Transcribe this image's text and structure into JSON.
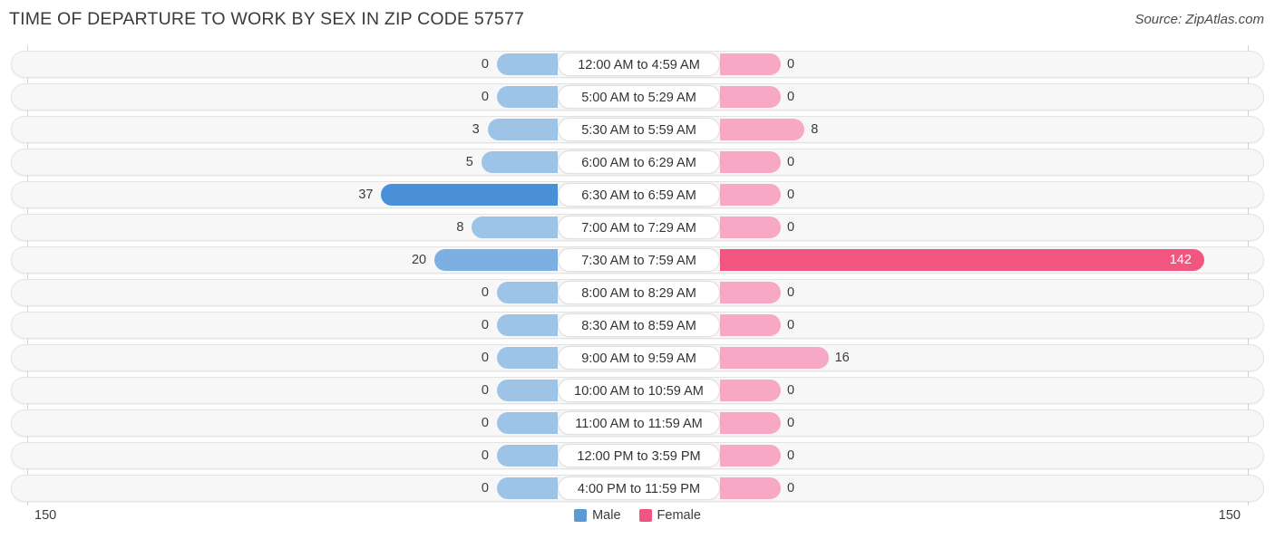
{
  "header": {
    "title": "TIME OF DEPARTURE TO WORK BY SEX IN ZIP CODE 57577",
    "source": "Source: ZipAtlas.com"
  },
  "legend": {
    "male_label": "Male",
    "female_label": "Female",
    "male_color": "#5b9bd5",
    "female_color": "#f2557f"
  },
  "axis": {
    "left_max": "150",
    "right_max": "150"
  },
  "chart_data": {
    "type": "bar",
    "title": "TIME OF DEPARTURE TO WORK BY SEX IN ZIP CODE 57577",
    "subtitle": "Source: ZipAtlas.com",
    "orientation": "horizontal-diverging",
    "xlabel": "",
    "ylabel": "",
    "xlim": [
      150,
      150
    ],
    "axis_max": 150,
    "grid": false,
    "legend_position": "bottom-center",
    "categories": [
      "12:00 AM to 4:59 AM",
      "5:00 AM to 5:29 AM",
      "5:30 AM to 5:59 AM",
      "6:00 AM to 6:29 AM",
      "6:30 AM to 6:59 AM",
      "7:00 AM to 7:29 AM",
      "7:30 AM to 7:59 AM",
      "8:00 AM to 8:29 AM",
      "8:30 AM to 8:59 AM",
      "9:00 AM to 9:59 AM",
      "10:00 AM to 10:59 AM",
      "11:00 AM to 11:59 AM",
      "12:00 PM to 3:59 PM",
      "4:00 PM to 11:59 PM"
    ],
    "series": [
      {
        "name": "Male",
        "color": "#5b9bd5",
        "values": [
          0,
          0,
          3,
          5,
          37,
          8,
          20,
          0,
          0,
          0,
          0,
          0,
          0,
          0
        ]
      },
      {
        "name": "Female",
        "color": "#f2557f",
        "values": [
          0,
          0,
          8,
          0,
          0,
          0,
          142,
          0,
          0,
          16,
          0,
          0,
          0,
          0
        ]
      }
    ]
  },
  "rows": [
    {
      "label": "12:00 AM to 4:59 AM",
      "male": "0",
      "female": "0",
      "male_v": 0,
      "female_v": 0
    },
    {
      "label": "5:00 AM to 5:29 AM",
      "male": "0",
      "female": "0",
      "male_v": 0,
      "female_v": 0
    },
    {
      "label": "5:30 AM to 5:59 AM",
      "male": "3",
      "female": "8",
      "male_v": 3,
      "female_v": 8
    },
    {
      "label": "6:00 AM to 6:29 AM",
      "male": "5",
      "female": "0",
      "male_v": 5,
      "female_v": 0
    },
    {
      "label": "6:30 AM to 6:59 AM",
      "male": "37",
      "female": "0",
      "male_v": 37,
      "female_v": 0
    },
    {
      "label": "7:00 AM to 7:29 AM",
      "male": "8",
      "female": "0",
      "male_v": 8,
      "female_v": 0
    },
    {
      "label": "7:30 AM to 7:59 AM",
      "male": "20",
      "female": "142",
      "male_v": 20,
      "female_v": 142
    },
    {
      "label": "8:00 AM to 8:29 AM",
      "male": "0",
      "female": "0",
      "male_v": 0,
      "female_v": 0
    },
    {
      "label": "8:30 AM to 8:59 AM",
      "male": "0",
      "female": "0",
      "male_v": 0,
      "female_v": 0
    },
    {
      "label": "9:00 AM to 9:59 AM",
      "male": "0",
      "female": "16",
      "male_v": 0,
      "female_v": 16
    },
    {
      "label": "10:00 AM to 10:59 AM",
      "male": "0",
      "female": "0",
      "male_v": 0,
      "female_v": 0
    },
    {
      "label": "11:00 AM to 11:59 AM",
      "male": "0",
      "female": "0",
      "male_v": 0,
      "female_v": 0
    },
    {
      "label": "12:00 PM to 3:59 PM",
      "male": "0",
      "female": "0",
      "male_v": 0,
      "female_v": 0
    },
    {
      "label": "4:00 PM to 11:59 PM",
      "male": "0",
      "female": "0",
      "male_v": 0,
      "female_v": 0
    }
  ]
}
